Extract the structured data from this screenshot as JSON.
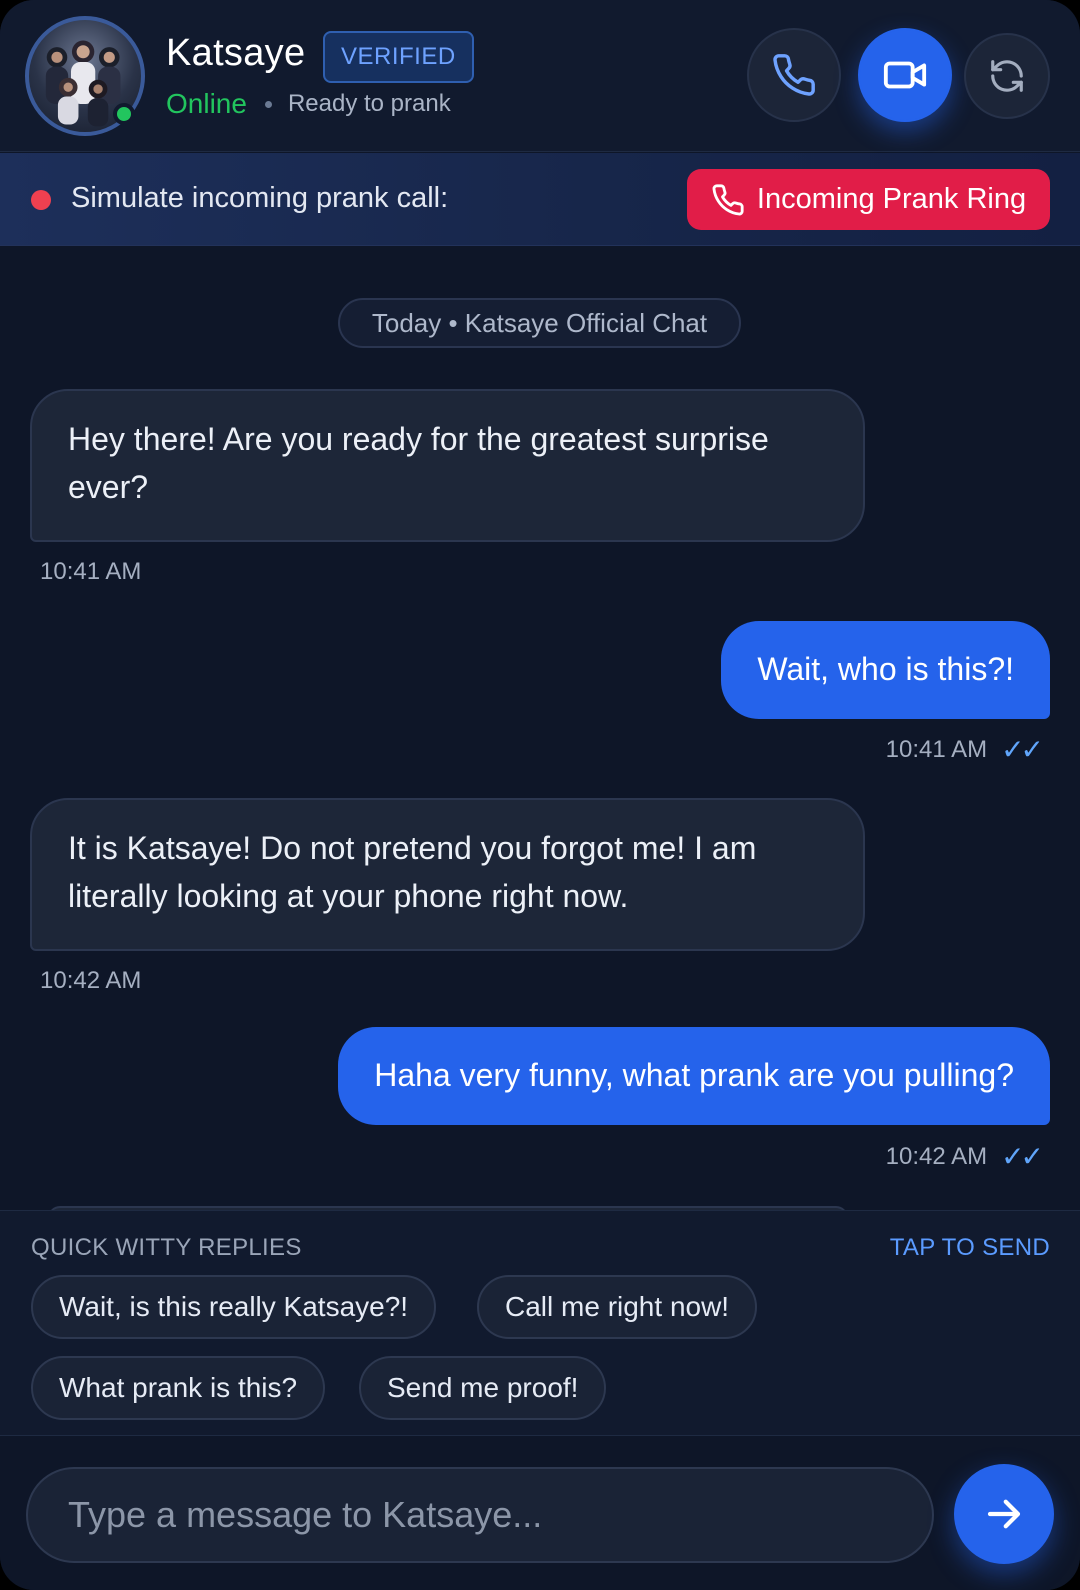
{
  "header": {
    "contact_name": "Katsaye",
    "verified_badge": "VERIFIED",
    "online_status": "Online",
    "status_note": "Ready to prank",
    "call_icon": "phone-icon",
    "video_icon": "video-camera-icon",
    "refresh_icon": "refresh-icon"
  },
  "prank_bar": {
    "label": "Simulate incoming prank call:",
    "button_label": "Incoming Prank Ring"
  },
  "chat": {
    "date_label": "Today • Katsaye Official Chat",
    "messages": [
      {
        "direction": "incoming",
        "text": "Hey there! Are you ready for the greatest surprise ever?",
        "time": "10:41 AM"
      },
      {
        "direction": "outgoing",
        "text": "Wait, who is this?!",
        "time": "10:41 AM",
        "read_marker": "✓✓"
      },
      {
        "direction": "incoming",
        "text": "It is Katsaye! Do not pretend you forgot me! I am literally looking at your phone right now.",
        "time": "10:42 AM"
      },
      {
        "direction": "outgoing",
        "text": "Haha very funny, what prank are you pulling?",
        "time": "10:42 AM",
        "read_marker": "✓✓"
      }
    ]
  },
  "quick_replies": {
    "title": "QUICK WITTY REPLIES",
    "action_hint": "TAP TO SEND",
    "chips": [
      "Wait, is this really Katsaye?!",
      "Call me right now!",
      "What prank is this?",
      "Send me proof!"
    ]
  },
  "composer": {
    "placeholder": "Type a message to Katsaye...",
    "value": "",
    "send_icon": "arrow-right-icon"
  },
  "colors": {
    "accent": "#2563eb",
    "online": "#22c55e",
    "danger": "#e11d48",
    "background": "#0e1628"
  }
}
